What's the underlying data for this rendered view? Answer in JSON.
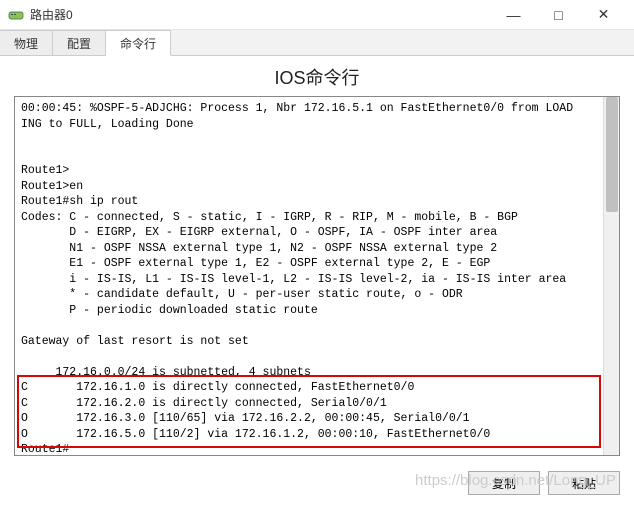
{
  "window": {
    "title": "路由器0",
    "min_label": "—",
    "max_label": "□",
    "close_label": "✕"
  },
  "tabs": {
    "items": [
      {
        "label": "物理"
      },
      {
        "label": "配置"
      },
      {
        "label": "命令行"
      }
    ],
    "active_index": 2
  },
  "content_title": "IOS命令行",
  "terminal": {
    "line_01": "00:00:45: %OSPF-5-ADJCHG: Process 1, Nbr 172.16.5.1 on FastEthernet0/0 from LOAD",
    "line_02": "ING to FULL, Loading Done",
    "line_03": "",
    "line_04": "",
    "line_05": "Route1>",
    "line_06": "Route1>en",
    "line_07": "Route1#sh ip rout",
    "line_08": "Codes: C - connected, S - static, I - IGRP, R - RIP, M - mobile, B - BGP",
    "line_09": "       D - EIGRP, EX - EIGRP external, O - OSPF, IA - OSPF inter area",
    "line_10": "       N1 - OSPF NSSA external type 1, N2 - OSPF NSSA external type 2",
    "line_11": "       E1 - OSPF external type 1, E2 - OSPF external type 2, E - EGP",
    "line_12": "       i - IS-IS, L1 - IS-IS level-1, L2 - IS-IS level-2, ia - IS-IS inter area",
    "line_13": "       * - candidate default, U - per-user static route, o - ODR",
    "line_14": "       P - periodic downloaded static route",
    "line_15": "",
    "line_16": "Gateway of last resort is not set",
    "line_17": "",
    "line_18": "     172.16.0.0/24 is subnetted, 4 subnets",
    "line_19": "C       172.16.1.0 is directly connected, FastEthernet0/0",
    "line_20": "C       172.16.2.0 is directly connected, Serial0/0/1",
    "line_21": "O       172.16.3.0 [110/65] via 172.16.2.2, 00:00:45, Serial0/0/1",
    "line_22": "O       172.16.5.0 [110/2] via 172.16.1.2, 00:00:10, FastEthernet0/0",
    "line_23": "Route1#"
  },
  "buttons": {
    "copy": "复制",
    "paste": "粘贴"
  },
  "watermark": "https://blog.csdn.net/Long_UP"
}
